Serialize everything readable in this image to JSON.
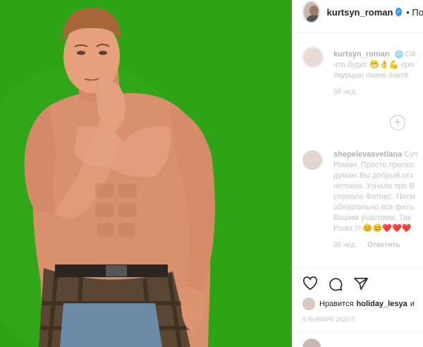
{
  "post": {
    "username": "kurtsyn_roman",
    "follow_label": "• По",
    "verified_mark": "✓"
  },
  "caption": {
    "username": "kurtsyn_roman",
    "line1_tail": "Ой ,",
    "line2": "что будет 😁👌💪 #ро",
    "line3": "#курцын #кино #актё",
    "time": "39 нед."
  },
  "comment": {
    "username": "shepelevasvetlana",
    "first_tail": "Суп",
    "lines": [
      "Роман. Просто прелес",
      "думаю Вы добрый.отз",
      "человек. Узнала про В",
      "сериала Фитнес. Посм",
      "обязательно все филь",
      "Вашим участием. Так",
      "Рома !!! 😊😊❤️❤️❤️"
    ],
    "time": "38 нед.",
    "reply_label": "Ответить"
  },
  "likes": {
    "prefix": "Нравится",
    "user": "holiday_lesya",
    "suffix": "и"
  },
  "date": "5 ЯНВАРЯ 2020 Г.",
  "colors": {
    "green_screen": "#2fa316",
    "verified": "#3897f0"
  },
  "icons": [
    "heart-icon",
    "comment-icon",
    "share-icon",
    "add-comment-icon",
    "verified-icon"
  ]
}
